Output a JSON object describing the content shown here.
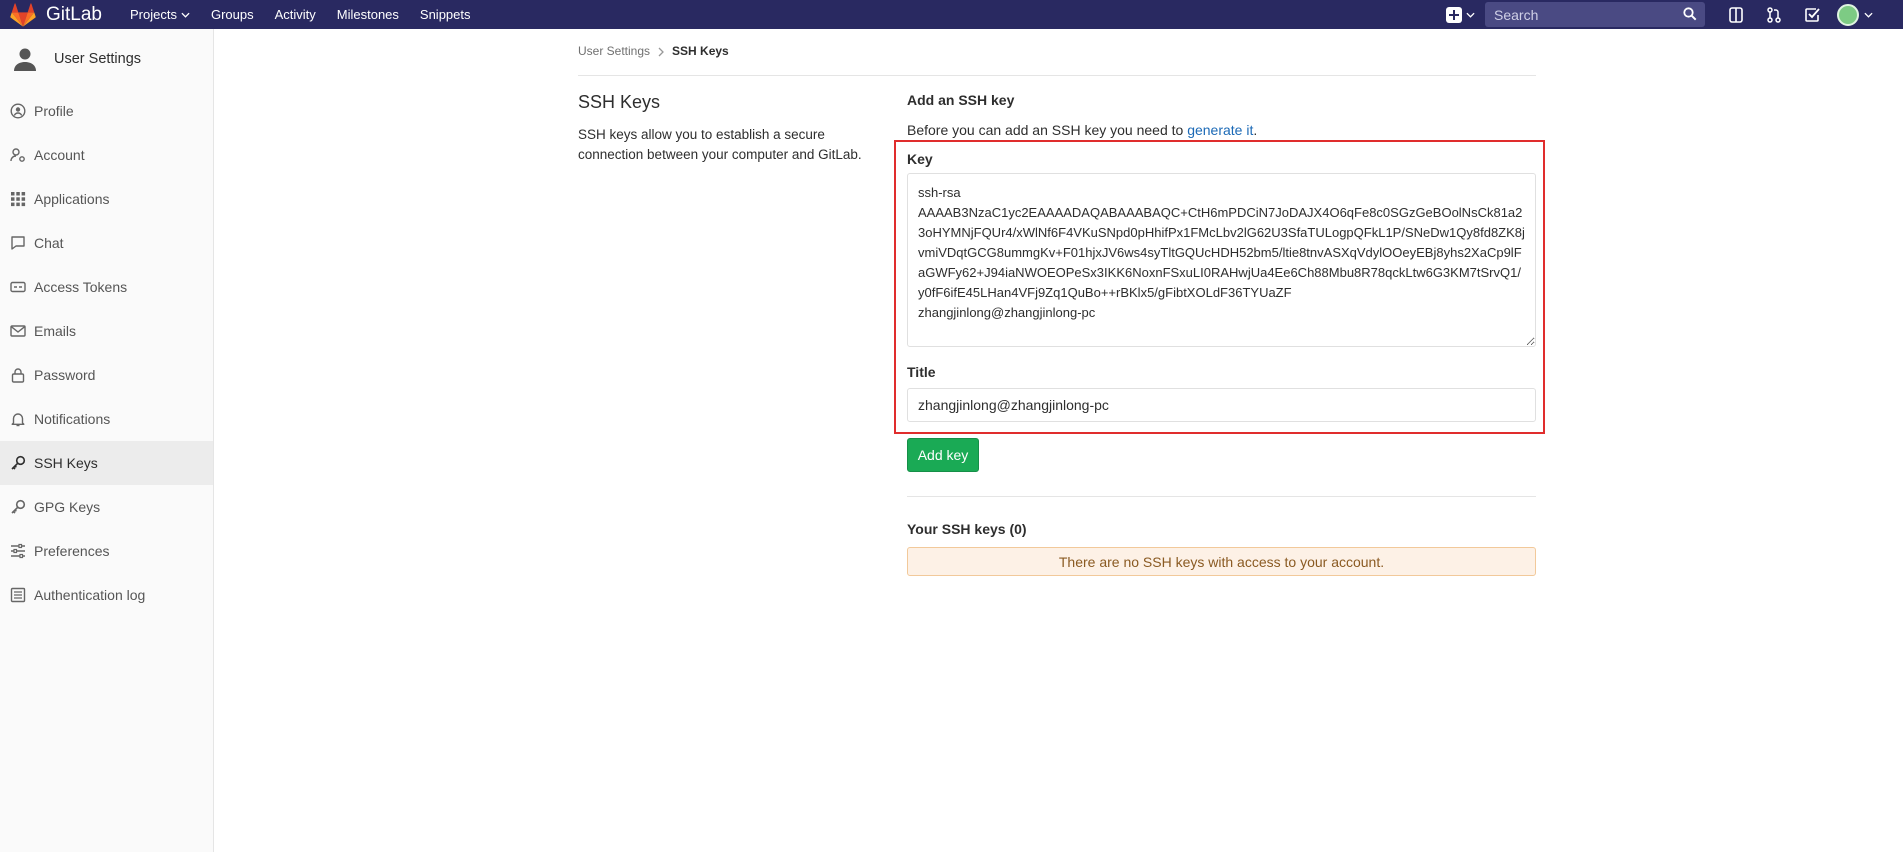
{
  "navbar": {
    "brand": "GitLab",
    "links": [
      {
        "label": "Projects",
        "has_dropdown": true
      },
      {
        "label": "Groups"
      },
      {
        "label": "Activity"
      },
      {
        "label": "Milestones"
      },
      {
        "label": "Snippets"
      }
    ],
    "search_placeholder": "Search",
    "icons": [
      "plus-square-icon",
      "chevron-down-icon",
      "search-icon",
      "sidebar-toggle-icon",
      "merge-request-icon",
      "todo-check-icon",
      "avatar"
    ]
  },
  "sidebar": {
    "title": "User Settings",
    "items": [
      {
        "label": "Profile",
        "icon": "user-circle-icon"
      },
      {
        "label": "Account",
        "icon": "user-gear-icon"
      },
      {
        "label": "Applications",
        "icon": "grid-icon"
      },
      {
        "label": "Chat",
        "icon": "chat-bubble-icon"
      },
      {
        "label": "Access Tokens",
        "icon": "token-icon"
      },
      {
        "label": "Emails",
        "icon": "envelope-icon"
      },
      {
        "label": "Password",
        "icon": "lock-icon"
      },
      {
        "label": "Notifications",
        "icon": "bell-icon"
      },
      {
        "label": "SSH Keys",
        "icon": "key-icon",
        "active": true
      },
      {
        "label": "GPG Keys",
        "icon": "key-icon"
      },
      {
        "label": "Preferences",
        "icon": "sliders-icon"
      },
      {
        "label": "Authentication log",
        "icon": "list-icon"
      }
    ]
  },
  "breadcrumb": {
    "parent": "User Settings",
    "current": "SSH Keys"
  },
  "section": {
    "title": "SSH Keys",
    "description": "SSH keys allow you to establish a secure connection between your computer and GitLab."
  },
  "form": {
    "heading": "Add an SSH key",
    "intro_text": "Before you can add an SSH key you need to ",
    "intro_link": "generate it",
    "intro_end": ".",
    "key_label": "Key",
    "key_value": "ssh-rsa\nAAAAB3NzaC1yc2EAAAADAQABAAABAQC+CtH6mPDCiN7JoDAJX4O6qFe8c0SGzGeBOolNsCk81a23oHYMNjFQUr4/xWlNf6F4VKuSNpd0pHhifPx1FMcLbv2lG62U3SfaTULogpQFkL1P/SNeDw1Qy8fd8ZK8jvmiVDqtGCG8ummgKv+F01hjxJV6ws4syTltGQUcHDH52bm5/ltie8tnvASXqVdylOOeyEBj8yhs2XaCp9lFaGWFy62+J94iaNWOEOPeSx3IKK6NoxnFSxuLI0RAHwjUa4Ee6Ch88Mbu8R78qckLtw6G3KM7tSrvQ1/y0fF6ifE45LHan4VFj9Zq1QuBo++rBKlx5/gFibtXOLdF36TYUaZF\nzhangjinlong@zhangjinlong-pc",
    "title_label": "Title",
    "title_value": "zhangjinlong@zhangjinlong-pc",
    "submit_label": "Add key"
  },
  "keys_list": {
    "heading": "Your SSH keys (0)",
    "empty_message": "There are no SSH keys with access to your account."
  },
  "colors": {
    "navbar_bg": "#292961",
    "add_button": "#1aaa55",
    "highlight_border": "#e02d2d",
    "link": "#1b69b6",
    "alert_bg": "#fdf1e6"
  }
}
